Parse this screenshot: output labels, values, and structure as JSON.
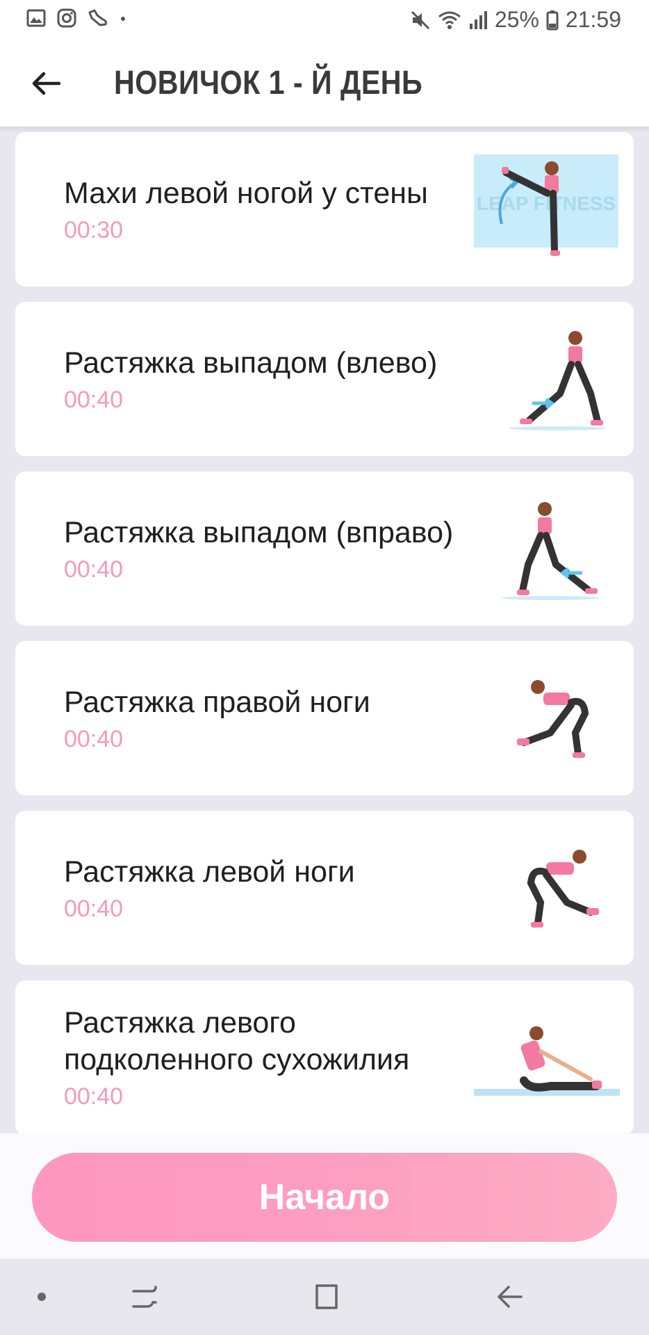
{
  "status_bar": {
    "battery": "25%",
    "time": "21:59",
    "left_icons": [
      "gallery-icon",
      "instagram-icon",
      "shoe-icon",
      "dot-icon"
    ],
    "right_icons": [
      "mute-icon",
      "wifi-icon",
      "signal-icon",
      "battery-icon"
    ]
  },
  "header": {
    "title": "НОВИЧОК 1 - Й ДЕНЬ",
    "back_icon": "back-arrow-icon"
  },
  "exercises": [
    {
      "name": "Махи левой ногой у стены",
      "time": "00:30",
      "illustration_watermark": "LEAP FITNESS"
    },
    {
      "name": "Растяжка выпадом (влево)",
      "time": "00:40"
    },
    {
      "name": "Растяжка выпадом (вправо)",
      "time": "00:40"
    },
    {
      "name": "Растяжка правой ноги",
      "time": "00:40"
    },
    {
      "name": "Растяжка левой ноги",
      "time": "00:40"
    },
    {
      "name": "Растяжка левого подколенного сухожилия",
      "time": "00:40"
    }
  ],
  "start_button": {
    "label": "Начало"
  },
  "nav_bar": {
    "icons": [
      "dot-icon",
      "recent-apps-icon",
      "home-icon",
      "back-icon"
    ]
  },
  "colors": {
    "accent_pink": "#f59ab9",
    "button_gradient_start": "#fe97bf",
    "button_gradient_end": "#fcacc5",
    "list_background": "#e8e6ef"
  }
}
